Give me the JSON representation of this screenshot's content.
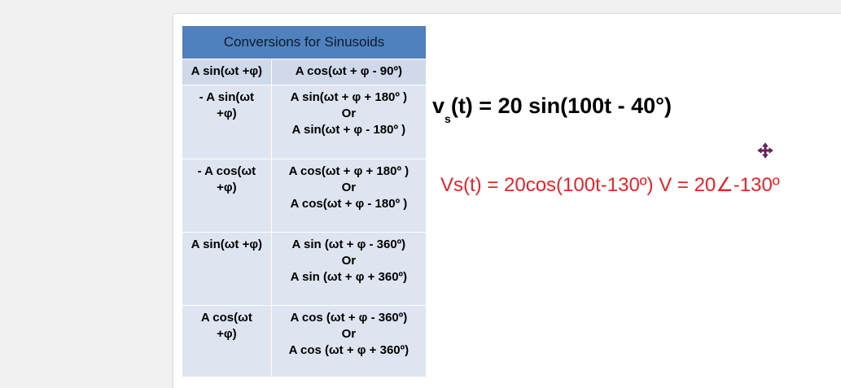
{
  "table": {
    "header": "Conversions for Sinusoids",
    "rows": [
      {
        "left": [
          "A sin(ωt +φ)"
        ],
        "right": [
          "A cos(ωt + φ - 90º)"
        ]
      },
      {
        "left": [
          "- A sin(ωt",
          "+φ)"
        ],
        "right": [
          "A sin(ωt + φ + 180º )",
          "Or",
          "A sin(ωt + φ - 180º )"
        ]
      },
      {
        "left": [
          "- A cos(ωt",
          "+φ)"
        ],
        "right": [
          "A cos(ωt + φ + 180º )",
          "Or",
          "A cos(ωt + φ - 180º )"
        ]
      },
      {
        "left": [
          "A sin(ωt +φ)"
        ],
        "right": [
          "A sin (ωt + φ - 360º)",
          "Or",
          "A sin (ωt + φ + 360º)"
        ]
      },
      {
        "left": [
          "A cos(ωt",
          "+φ)"
        ],
        "right": [
          "A cos (ωt + φ - 360º)",
          "Or",
          "A cos (ωt + φ + 360º)"
        ]
      }
    ]
  },
  "equation1": {
    "v": "v",
    "sub": "s",
    "rest": "(t) = 20 sin(100t - 40°)"
  },
  "equation2": {
    "text": "Vs(t) = 20cos(100t-130º) V = 20∠-130º"
  },
  "icons": {
    "cursor": "move-cursor-icon"
  },
  "colors": {
    "header": "#4f81bd",
    "row": "#dee5f1",
    "accent": "#e8222a"
  }
}
